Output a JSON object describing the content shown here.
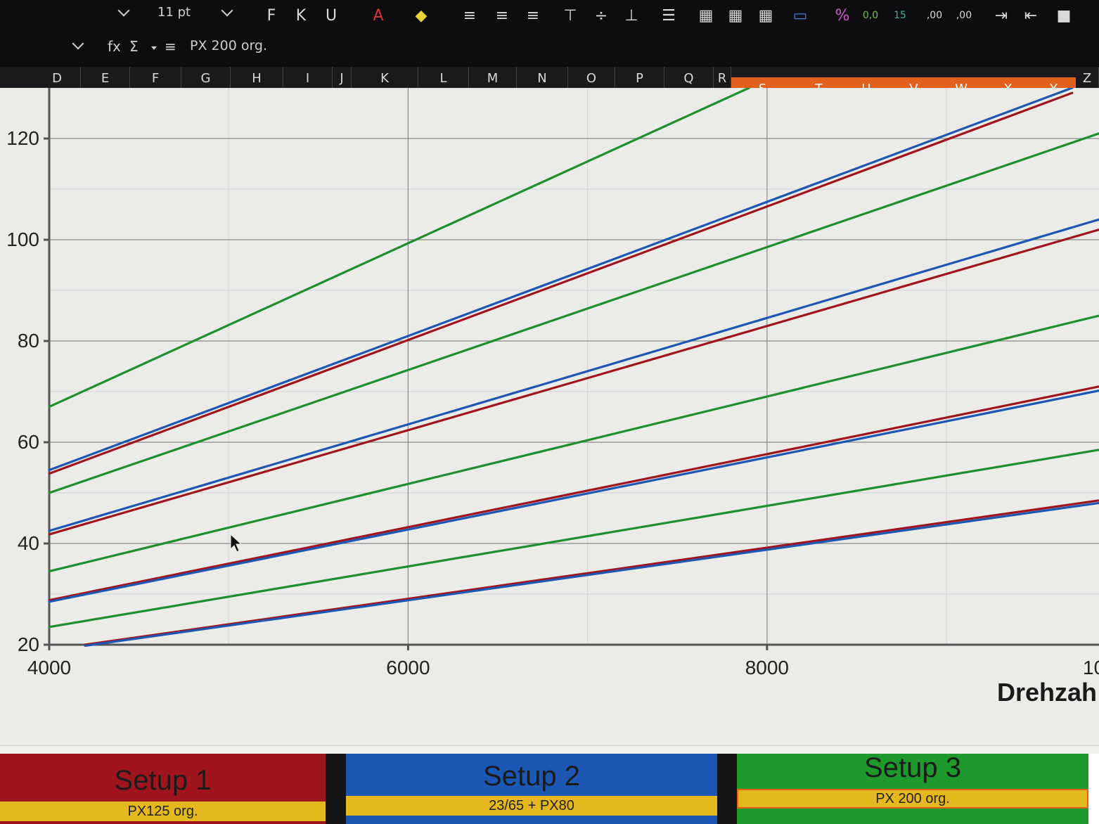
{
  "toolbar": {
    "font_size": "11 pt",
    "name_box": "PX 200 org.",
    "buttons": [
      {
        "name": "bold-button",
        "glyph": "F"
      },
      {
        "name": "italic-button",
        "glyph": "K"
      },
      {
        "name": "underline-button",
        "glyph": "U"
      },
      {
        "name": "font-color-button",
        "glyph": "A"
      },
      {
        "name": "highlight-button",
        "glyph": "◆"
      },
      {
        "name": "align-left-button",
        "glyph": "≡"
      },
      {
        "name": "align-center-button",
        "glyph": "≡"
      },
      {
        "name": "align-right-button",
        "glyph": "≡"
      },
      {
        "name": "align-top-button",
        "glyph": "⊤"
      },
      {
        "name": "align-middle-button",
        "glyph": "÷"
      },
      {
        "name": "align-bottom-button",
        "glyph": "⊥"
      },
      {
        "name": "wrap-text-button",
        "glyph": "☰"
      },
      {
        "name": "merge-cells-button",
        "glyph": "▦"
      },
      {
        "name": "unmerge-cells-button",
        "glyph": "▦"
      },
      {
        "name": "borders-button",
        "glyph": "▦"
      },
      {
        "name": "currency-format-button",
        "glyph": "▭"
      },
      {
        "name": "percent-format-button",
        "glyph": "%"
      },
      {
        "name": "number-format-button",
        "glyph": "0,0"
      },
      {
        "name": "date-format-button",
        "glyph": "15"
      },
      {
        "name": "add-decimal-button",
        "glyph": ",00"
      },
      {
        "name": "remove-decimal-button",
        "glyph": ",00"
      },
      {
        "name": "increase-indent-button",
        "glyph": "⇥"
      },
      {
        "name": "decrease-indent-button",
        "glyph": "⇤"
      },
      {
        "name": "background-color-button",
        "glyph": "■"
      }
    ],
    "formula_icons": {
      "function_wizard": "fx",
      "sum": "Σ",
      "formula": "≡"
    }
  },
  "columns": [
    "D",
    "E",
    "F",
    "G",
    "H",
    "I",
    "J",
    "K",
    "L",
    "M",
    "N",
    "O",
    "P",
    "Q",
    "R",
    "S",
    "T",
    "U",
    "V",
    "W",
    "X",
    "Y",
    "Z"
  ],
  "selected_columns": [
    "S",
    "T",
    "U",
    "V",
    "W",
    "X",
    "Y"
  ],
  "colors": {
    "setup1": "#a0151d",
    "setup2": "#1c57b4",
    "setup3": "#1e8f2e",
    "subtitle_bg": "#e4b81e",
    "column_selected": "#e35f1c"
  },
  "chart_data": {
    "type": "line",
    "xlabel": "Drehzah",
    "x_tick_labels": [
      "4000",
      "6000",
      "8000",
      "10"
    ],
    "y_tick_labels": [
      "20",
      "40",
      "60",
      "80",
      "100",
      "120"
    ],
    "xlim": [
      4000,
      9850
    ],
    "ylim": [
      20,
      130
    ],
    "grid": true,
    "series": [
      {
        "setup": "setup3",
        "color": "#1e8f2e",
        "x": [
          4000,
          7900
        ],
        "y": [
          67,
          130
        ]
      },
      {
        "setup": "setup2",
        "color": "#1c57b4",
        "x": [
          4000,
          9700
        ],
        "y": [
          54.5,
          130
        ]
      },
      {
        "setup": "setup1",
        "color": "#a0151d",
        "x": [
          4000,
          9700
        ],
        "y": [
          53.8,
          129
        ]
      },
      {
        "setup": "setup3",
        "color": "#1e8f2e",
        "x": [
          4000,
          9850
        ],
        "y": [
          50,
          121
        ]
      },
      {
        "setup": "setup2",
        "color": "#1c57b4",
        "x": [
          4000,
          9850
        ],
        "y": [
          42.5,
          104
        ]
      },
      {
        "setup": "setup1",
        "color": "#a0151d",
        "x": [
          4000,
          9850
        ],
        "y": [
          41.8,
          102
        ]
      },
      {
        "setup": "setup3",
        "color": "#1e8f2e",
        "x": [
          4000,
          9850
        ],
        "y": [
          34.5,
          85
        ]
      },
      {
        "setup": "setup1",
        "color": "#a0151d",
        "x": [
          4000,
          9850
        ],
        "y": [
          28.8,
          71
        ]
      },
      {
        "setup": "setup2",
        "color": "#1c57b4",
        "x": [
          4000,
          9850
        ],
        "y": [
          28.5,
          70.2
        ]
      },
      {
        "setup": "setup3",
        "color": "#1e8f2e",
        "x": [
          4000,
          9850
        ],
        "y": [
          23.5,
          58.5
        ]
      },
      {
        "setup": "setup1",
        "color": "#a0151d",
        "x": [
          4200,
          9850
        ],
        "y": [
          20,
          48.5
        ]
      },
      {
        "setup": "setup2",
        "color": "#1c57b4",
        "x": [
          4200,
          9850
        ],
        "y": [
          19.8,
          48
        ]
      }
    ]
  },
  "setups": [
    {
      "title": "Setup 1",
      "subtitle": "PX125 org."
    },
    {
      "title": "Setup 2",
      "subtitle": "23/65 + PX80"
    },
    {
      "title": "Setup 3",
      "subtitle": "PX 200 org."
    }
  ]
}
